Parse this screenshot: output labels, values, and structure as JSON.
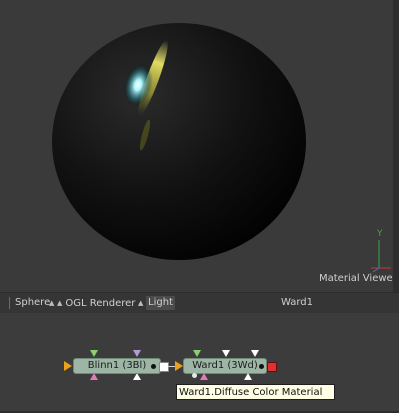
{
  "viewer": {
    "label": "Material Viewer",
    "axis_label": "Y"
  },
  "tabs": [
    {
      "label": "Sphere"
    },
    {
      "label": "OGL Renderer"
    },
    {
      "label": "Light"
    }
  ],
  "active_tab": "Light",
  "tab_right_label": "Ward1",
  "nodes": {
    "blinn": {
      "label": "Blinn1  (3Bl)"
    },
    "ward": {
      "label": "Ward1  (3Wd)"
    }
  },
  "tooltip": "Ward1.Diffuse Color Material",
  "colors": {
    "node_fill": "#9cb5a4",
    "highlight_cyan": "#aef6ff",
    "highlight_yellow": "#f4f06a",
    "axis_green": "#3aa84a",
    "axis_red": "#d43030",
    "input_triangle_yellow": "#e9a21b",
    "output_red": "#e03030"
  }
}
